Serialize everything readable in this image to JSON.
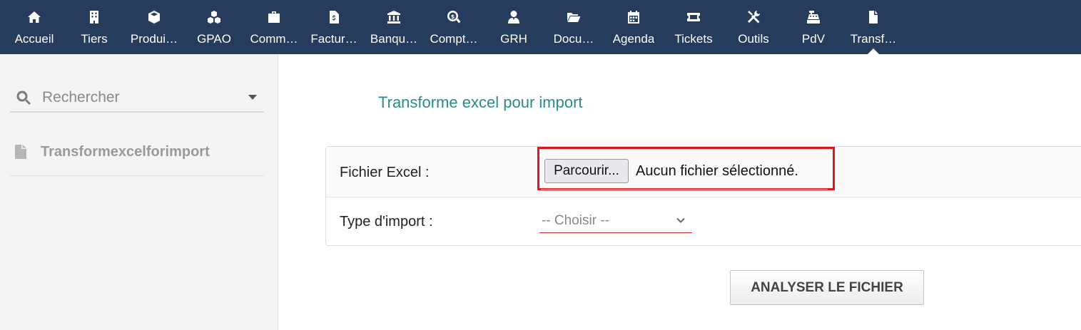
{
  "topbar": {
    "items": [
      {
        "label": "Accueil",
        "icon": "home-icon"
      },
      {
        "label": "Tiers",
        "icon": "building-icon"
      },
      {
        "label": "Produi…",
        "icon": "cube-icon"
      },
      {
        "label": "GPAO",
        "icon": "cubes-icon"
      },
      {
        "label": "Comm…",
        "icon": "suitcase-icon"
      },
      {
        "label": "Factur…",
        "icon": "invoice-icon"
      },
      {
        "label": "Banqu…",
        "icon": "bank-icon"
      },
      {
        "label": "Compt…",
        "icon": "search-dollar-icon"
      },
      {
        "label": "GRH",
        "icon": "user-tie-icon"
      },
      {
        "label": "Docu…",
        "icon": "folder-open-icon"
      },
      {
        "label": "Agenda",
        "icon": "calendar-icon"
      },
      {
        "label": "Tickets",
        "icon": "ticket-icon"
      },
      {
        "label": "Outils",
        "icon": "tools-icon"
      },
      {
        "label": "PdV",
        "icon": "cash-register-icon"
      },
      {
        "label": "Transf…",
        "icon": "file-icon"
      }
    ],
    "active_index": 14,
    "background": "#263c5c"
  },
  "sidebar": {
    "search_placeholder": "Rechercher",
    "entry_label": "Transformexcelforimport"
  },
  "main": {
    "title": "Transforme excel pour import",
    "file_label": "Fichier Excel :",
    "browse_label": "Parcourir...",
    "file_status": "Aucun fichier sélectionné.",
    "import_type_label": "Type d'import :",
    "import_type_value": "-- Choisir --",
    "analyze_label": "ANALYSER LE FICHIER"
  },
  "colors": {
    "accent_title": "#2a8c8a",
    "highlight": "#e0161e"
  }
}
